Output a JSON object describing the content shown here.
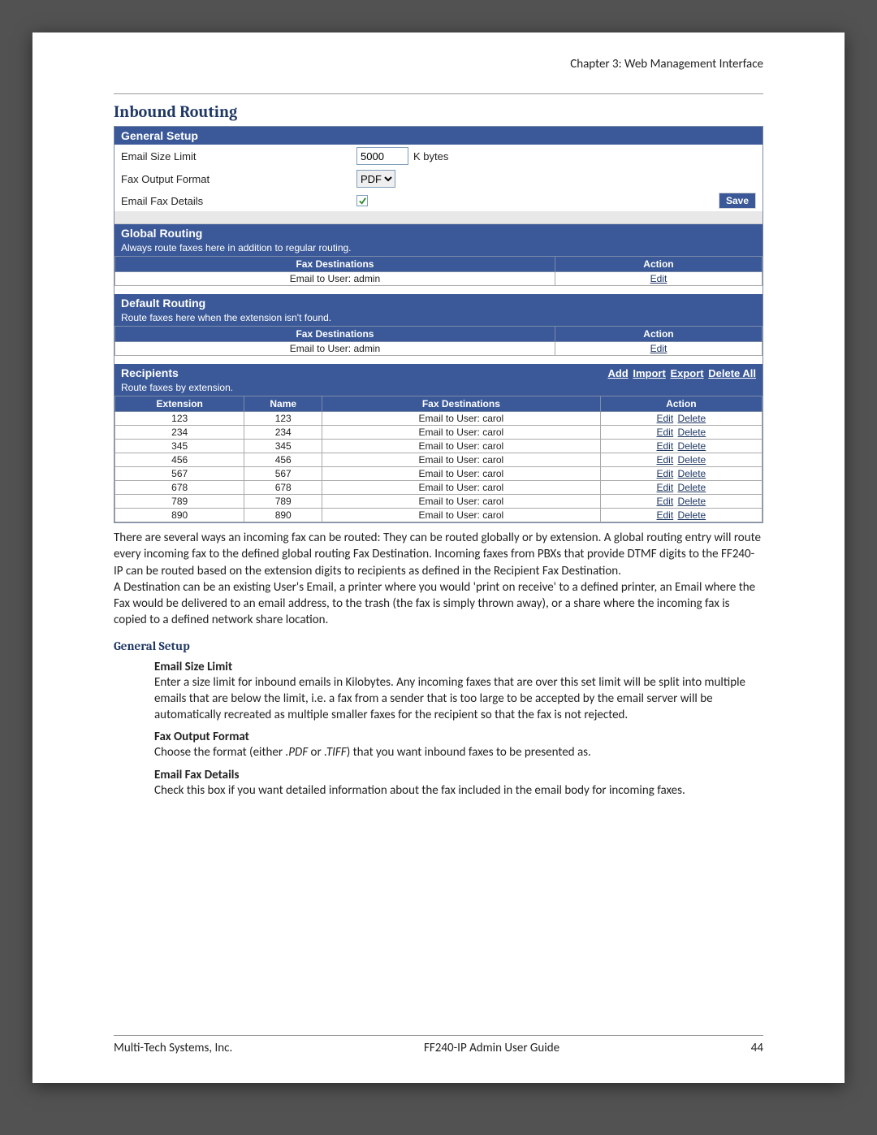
{
  "header": {
    "chapter": "Chapter 3: Web Management Interface"
  },
  "title": "Inbound Routing",
  "general_setup": {
    "header": "General Setup",
    "email_size_label": "Email Size Limit",
    "email_size_value": "5000",
    "email_size_unit": "K bytes",
    "fax_output_label": "Fax Output Format",
    "fax_output_value": "PDF",
    "email_fax_details_label": "Email Fax Details",
    "save_label": "Save"
  },
  "global_routing": {
    "header": "Global Routing",
    "subtext": "Always route faxes here in addition to regular routing.",
    "col_fax": "Fax Destinations",
    "col_action": "Action",
    "row_dest": "Email to User: admin",
    "row_edit": "Edit"
  },
  "default_routing": {
    "header": "Default Routing",
    "subtext": "Route faxes here when the extension isn't found.",
    "col_fax": "Fax Destinations",
    "col_action": "Action",
    "row_dest": "Email to User: admin",
    "row_edit": "Edit"
  },
  "recipients": {
    "header": "Recipients",
    "subtext": "Route faxes by extension.",
    "links": {
      "add": "Add",
      "import": "Import",
      "export": "Export",
      "delete_all": "Delete All"
    },
    "cols": {
      "ext": "Extension",
      "name": "Name",
      "fax": "Fax Destinations",
      "action": "Action"
    },
    "action_edit": "Edit",
    "action_delete": "Delete",
    "rows": [
      {
        "ext": "123",
        "name": "123",
        "dest": "Email to User: carol"
      },
      {
        "ext": "234",
        "name": "234",
        "dest": "Email to User: carol"
      },
      {
        "ext": "345",
        "name": "345",
        "dest": "Email to User: carol"
      },
      {
        "ext": "456",
        "name": "456",
        "dest": "Email to User: carol"
      },
      {
        "ext": "567",
        "name": "567",
        "dest": "Email to User: carol"
      },
      {
        "ext": "678",
        "name": "678",
        "dest": "Email to User: carol"
      },
      {
        "ext": "789",
        "name": "789",
        "dest": "Email to User: carol"
      },
      {
        "ext": "890",
        "name": "890",
        "dest": "Email to User: carol"
      }
    ]
  },
  "body": {
    "p1": "There are several ways an incoming fax can be routed: They can be routed globally or by extension. A global routing entry will route every incoming fax to the defined global routing Fax Destination. Incoming faxes from PBXs that provide DTMF digits to the FF240-IP can be routed based on the extension digits to recipients as defined in the Recipient Fax Destination.",
    "p2": "A Destination can be an existing User's Email, a printer where you would 'print on receive' to a defined printer, an Email where the Fax would be delivered to an email address, to the trash (the fax is simply thrown away), or a share where the incoming fax is copied to a defined network share location."
  },
  "gs_heading": "General Setup",
  "gs_fields": {
    "f1_title": "Email Size Limit",
    "f1_desc": "Enter a size limit for inbound emails in Kilobytes. Any incoming faxes that are over this set limit will be split into multiple emails that are below the limit, i.e. a fax from a sender that is too large to be accepted by the email server will be automatically recreated as multiple smaller faxes for the recipient so that the fax is not rejected.",
    "f2_title": "Fax Output Format",
    "f2_desc_a": "Choose the format (either ",
    "f2_desc_b": ".PDF",
    "f2_desc_c": " or ",
    "f2_desc_d": ".TIFF",
    "f2_desc_e": ") that you want inbound faxes to be presented as.",
    "f3_title": "Email Fax Details",
    "f3_desc": "Check this box if you want detailed information about the fax included in the email body for incoming faxes."
  },
  "footer": {
    "left": "Multi-Tech Systems, Inc.",
    "center": "FF240-IP Admin User Guide",
    "right": "44"
  }
}
